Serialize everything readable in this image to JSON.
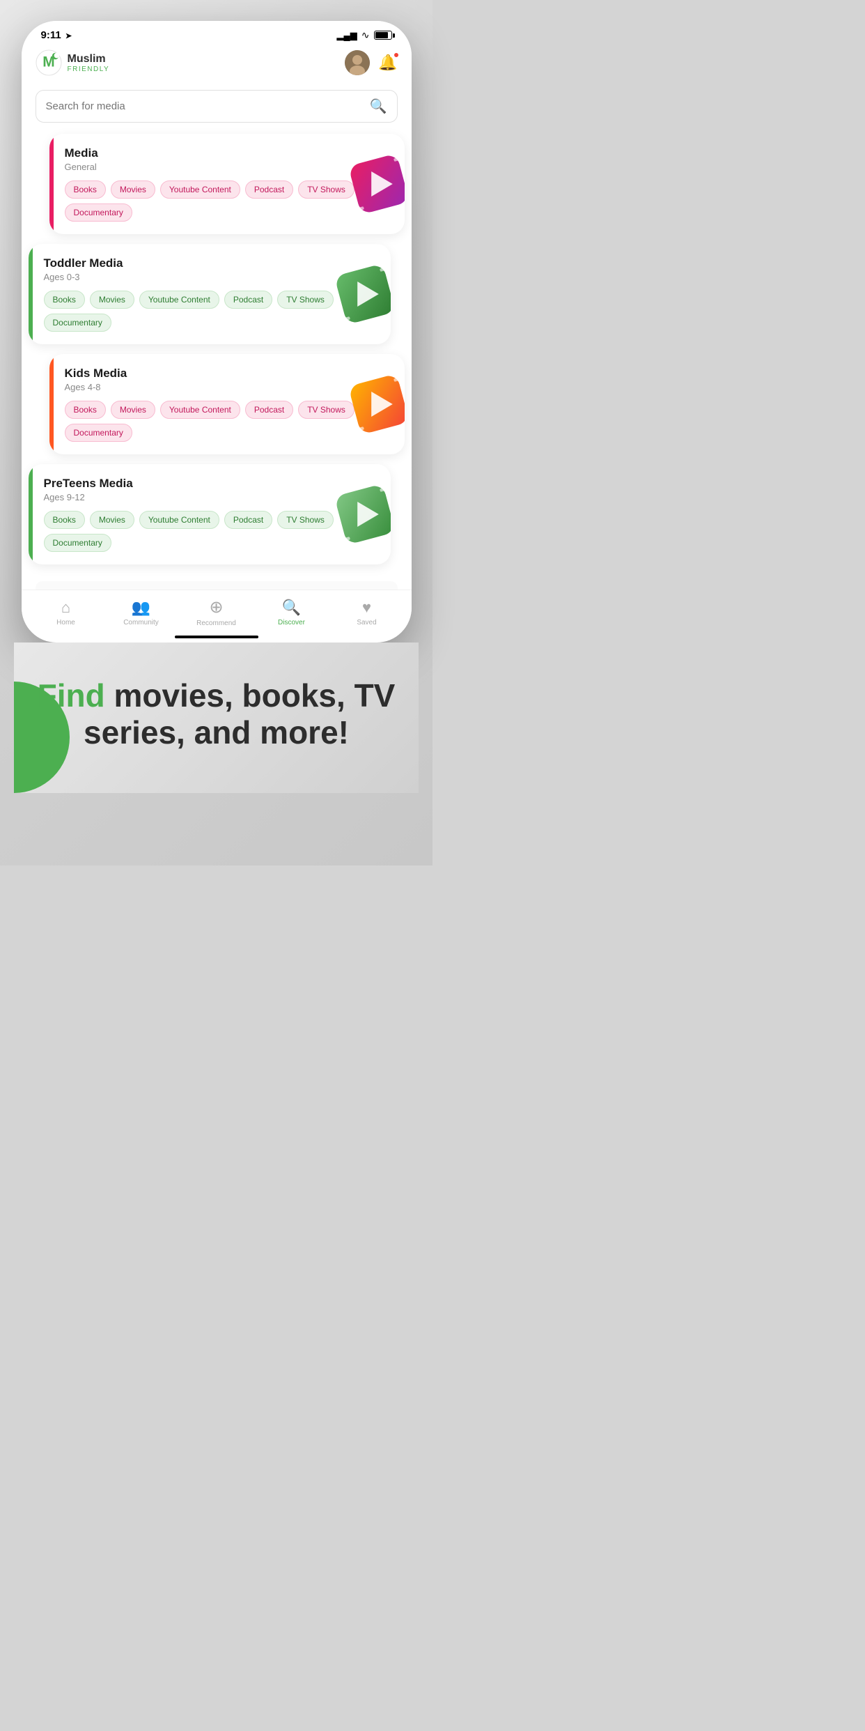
{
  "statusBar": {
    "time": "9:11",
    "arrowIcon": "➤"
  },
  "header": {
    "logoText": "Muslim",
    "logoSub": "FRIENDLY",
    "searchPlaceholder": "Search for media"
  },
  "nav": {
    "items": [
      {
        "id": "home",
        "label": "Home",
        "icon": "⌂",
        "active": false
      },
      {
        "id": "community",
        "label": "Community",
        "icon": "👥",
        "active": false
      },
      {
        "id": "recommend",
        "label": "Recommend",
        "icon": "⊕",
        "active": false
      },
      {
        "id": "discover",
        "label": "Discover",
        "icon": "🔍",
        "active": true
      },
      {
        "id": "saved",
        "label": "Saved",
        "icon": "♥",
        "active": false
      }
    ]
  },
  "cards": [
    {
      "id": "general",
      "title": "Media",
      "subtitle": "General",
      "accentColor": "#e91e63",
      "iconColor": "red",
      "tagStyle": "pink",
      "tags": [
        "Books",
        "Movies",
        "Youtube Content",
        "Podcast",
        "TV Shows",
        "Documentary"
      ]
    },
    {
      "id": "toddler",
      "title": "Toddler Media",
      "subtitle": "Ages 0-3",
      "accentColor": "#4caf50",
      "iconColor": "green",
      "tagStyle": "green",
      "tags": [
        "Books",
        "Movies",
        "Youtube Content",
        "Podcast",
        "TV Shows",
        "Documentary"
      ]
    },
    {
      "id": "kids",
      "title": "Kids Media",
      "subtitle": "Ages 4-8",
      "accentColor": "#ff5722",
      "iconColor": "orange",
      "tagStyle": "pink",
      "tags": [
        "Books",
        "Movies",
        "Youtube Content",
        "Podcast",
        "TV Shows",
        "Documentary"
      ]
    },
    {
      "id": "preteens",
      "title": "PreTeens Media",
      "subtitle": "Ages 9-12",
      "accentColor": "#4caf50",
      "iconColor": "green2",
      "tagStyle": "green",
      "tags": [
        "Books",
        "Movies",
        "Youtube Content",
        "Podcast",
        "TV Shows",
        "Documentary"
      ]
    }
  ],
  "promo": {
    "find": "Find",
    "rest": " movies, books, TV series, and more!"
  }
}
